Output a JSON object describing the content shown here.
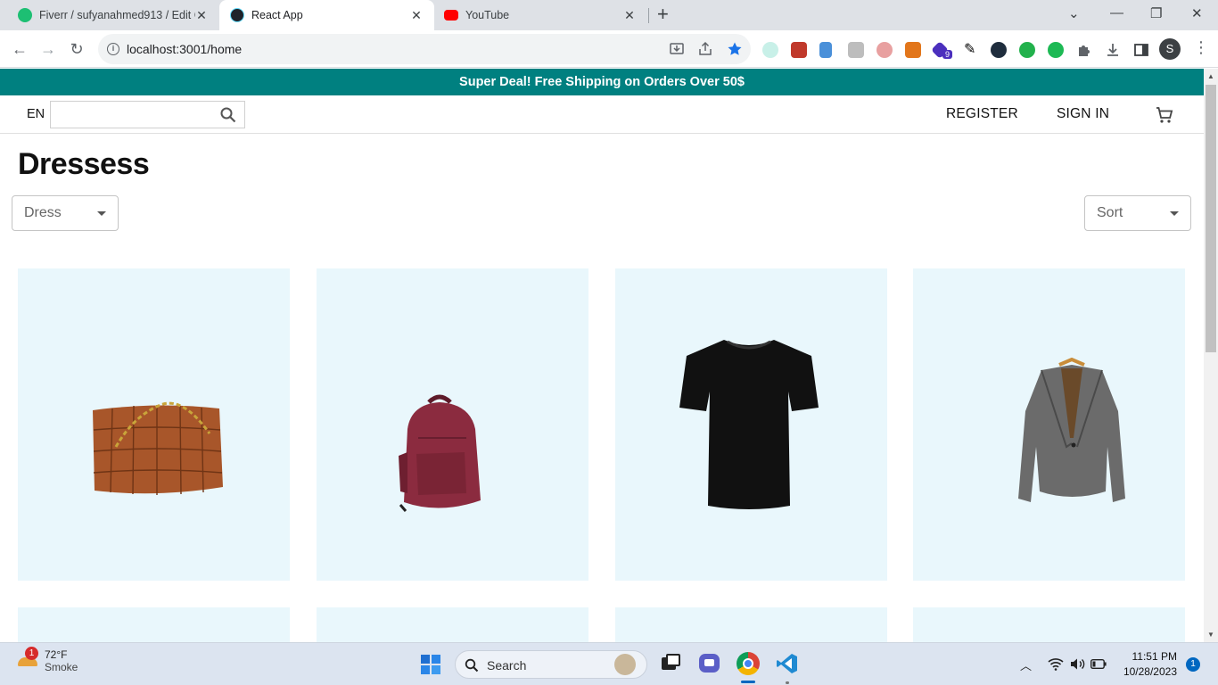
{
  "browser": {
    "tabs": [
      {
        "title": "Fiverr / sufyanahmed913 / Edit G",
        "favicon": "fiverr-icon",
        "color": "#1dbf73"
      },
      {
        "title": "React App",
        "favicon": "react-icon",
        "color": "#61dafb",
        "active": true
      },
      {
        "title": "YouTube",
        "favicon": "youtube-icon",
        "color": "#ff0000"
      }
    ],
    "url": "localhost:3001/home",
    "profile_initial": "S",
    "extension_badge": "9"
  },
  "site": {
    "announcement": "Super Deal! Free Shipping on Orders Over 50$",
    "accent_color": "#008080",
    "language": "EN",
    "search_placeholder": "",
    "nav": {
      "register": "REGISTER",
      "sign_in": "SIGN IN"
    }
  },
  "main": {
    "title": "Dressess",
    "filter_value": "Dress",
    "sort_value": "Sort",
    "products": [
      {
        "name": "woven-leather-tote-bag"
      },
      {
        "name": "burgundy-leather-backpack"
      },
      {
        "name": "black-tshirt"
      },
      {
        "name": "grey-blazer"
      }
    ]
  },
  "taskbar": {
    "weather_badge": "1",
    "temperature": "72°F",
    "condition": "Smoke",
    "search_label": "Search",
    "time": "11:51 PM",
    "date": "10/28/2023",
    "notification_count": "1"
  }
}
